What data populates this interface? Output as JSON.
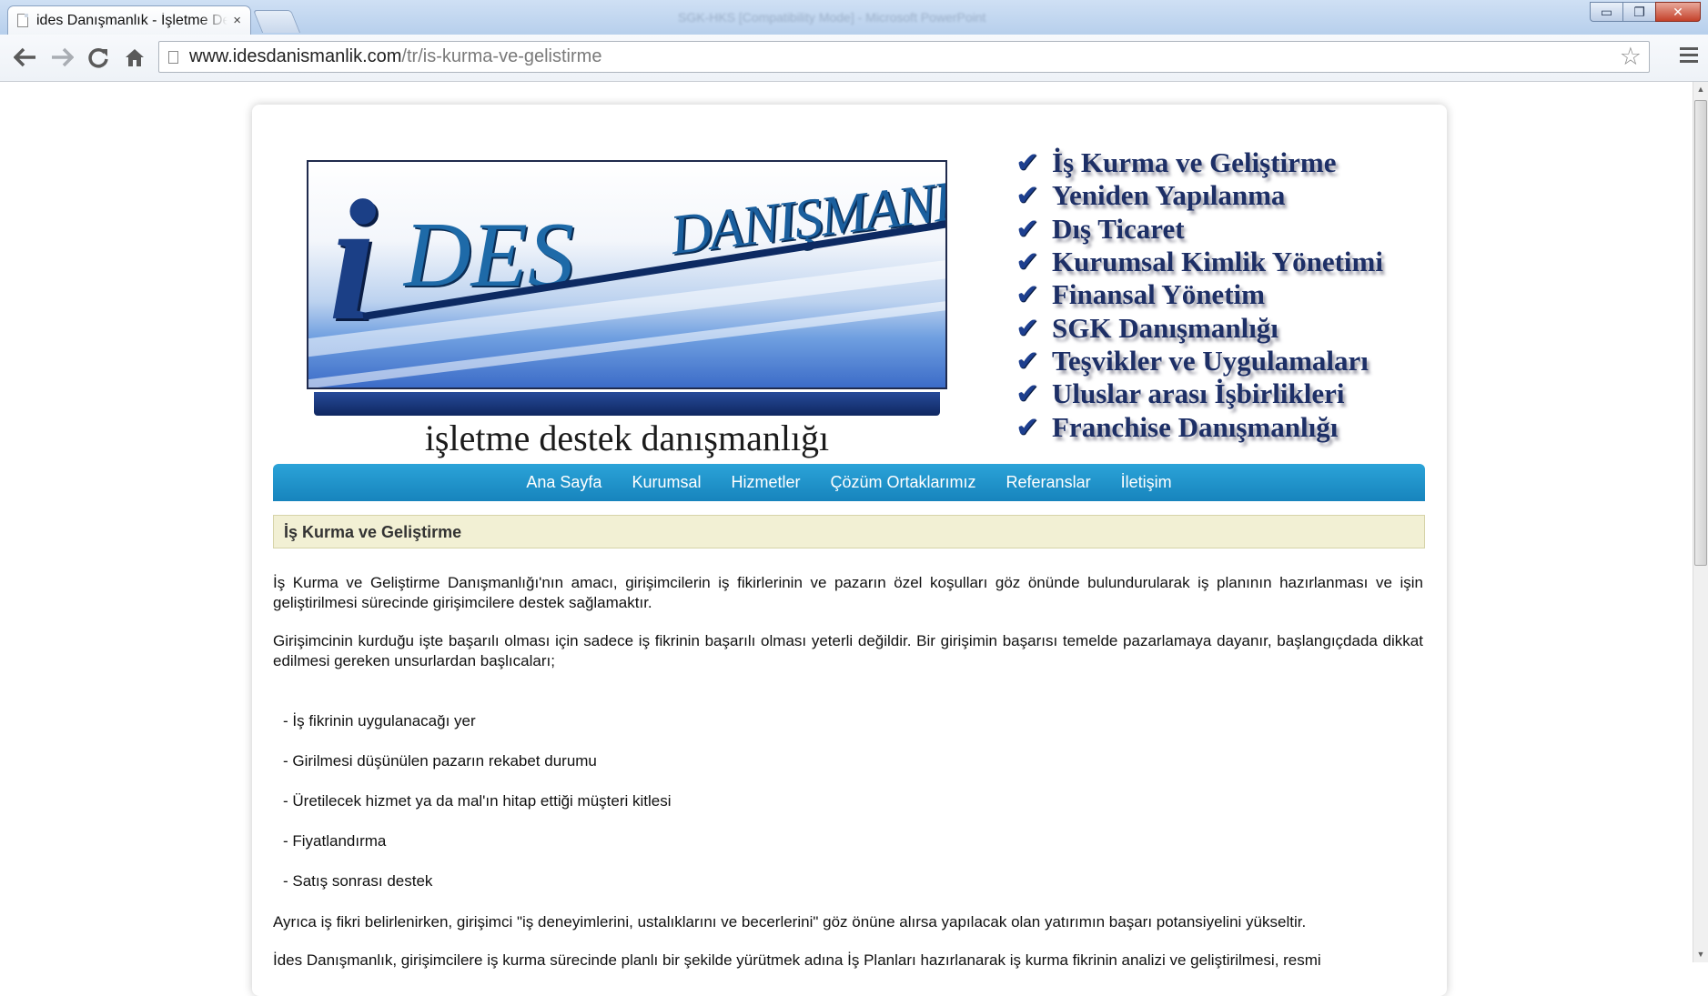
{
  "browser": {
    "tab_title": "ides Danışmanlık - İşletme Destek Danışmanlığı",
    "tab_close": "×",
    "window_title_ghost": "SGK-HKS [Compatibility Mode] - Microsoft PowerPoint",
    "url_domain": "www.idesdanismanlik.com",
    "url_path": "/tr/is-kurma-ve-gelistirme",
    "icons": {
      "back": "back-arrow-icon",
      "forward": "forward-arrow-icon",
      "reload": "reload-icon",
      "home": "home-icon",
      "bookmark": "star-icon",
      "menu": "hamburger-menu-icon"
    },
    "win_buttons": {
      "minimize": "▭",
      "maximize": "❐",
      "close": "✕"
    }
  },
  "header": {
    "logo": {
      "letter": "i",
      "wordmark": "DES",
      "subword": "DANIŞMANLIK"
    },
    "tagline": "işletme destek danışmanlığı",
    "services": [
      "İş Kurma ve Geliştirme",
      "Yeniden Yapılanma",
      "Dış Ticaret",
      "Kurumsal Kimlik Yönetimi",
      "Finansal Yönetim",
      "SGK Danışmanlığı",
      "Teşvikler ve Uygulamaları",
      "Uluslar arası İşbirlikleri",
      "Franchise Danışmanlığı"
    ]
  },
  "nav": [
    "Ana Sayfa",
    "Kurumsal",
    "Hizmetler",
    "Çözüm Ortaklarımız",
    "Referanslar",
    "İletişim"
  ],
  "main": {
    "title": "İş Kurma ve Geliştirme",
    "paragraph1": "İş Kurma ve Geliştirme Danışmanlığı'nın amacı, girişimcilerin iş fikirlerinin ve pazarın özel koşulları göz önünde bulundurularak iş planının hazırlanması ve işin geliştirilmesi sürecinde girişimcilere destek sağlamaktır.",
    "paragraph2": "Girişimcinin kurduğu işte başarılı olması için sadece iş fikrinin başarılı olması yeterli değildir. Bir girişimin başarısı temelde pazarlamaya dayanır, başlangıçdada dikkat edilmesi gereken unsurlardan başlıcaları;",
    "list": [
      "- İş fikrinin uygulanacağı yer",
      "- Girilmesi düşünülen pazarın rekabet durumu",
      "- Üretilecek hizmet ya da mal'ın hitap ettiği müşteri kitlesi",
      "- Fiyatlandırma",
      "- Satış sonrası destek"
    ],
    "paragraph3": "Ayrıca iş fikri belirlenirken, girişimci  \"iş deneyimlerini, ustalıklarını ve becerlerini\" göz önüne alırsa yapılacak olan yatırımın başarı potansiyelini yükseltir.",
    "paragraph4": "İdes Danışmanlık, girişimcilere iş kurma sürecinde planlı bir şekilde yürütmek adına İş Planları hazırlanarak iş kurma fikrinin analizi ve geliştirilmesi, resmi"
  },
  "colors": {
    "nav_bar": "#1f94cc",
    "title_bg": "#f2f0d4",
    "brand_navy": "#1d2f66"
  }
}
